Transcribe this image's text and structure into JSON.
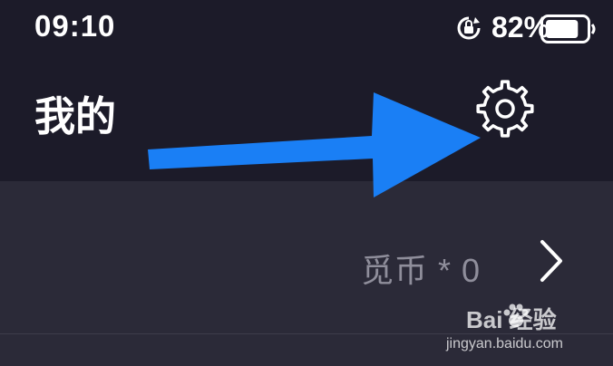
{
  "status_bar": {
    "time": "09:10",
    "battery_percent": "82%",
    "battery_level": 0.82,
    "icons": [
      "rotation-lock-icon",
      "battery-icon"
    ]
  },
  "header": {
    "title": "我的",
    "settings_icon": "gear-icon"
  },
  "overlay": {
    "arrow_color": "#1a7ff5"
  },
  "coins_row": {
    "label": "觅币 * 0",
    "chevron_icon": "chevron-right-icon"
  },
  "watermark": {
    "logo_text": "Bai 经验",
    "url": "jingyan.baidu.com"
  },
  "colors": {
    "header_bg": "#1c1b29",
    "body_bg": "#2b2a38",
    "muted_text": "#8f8e9b"
  }
}
